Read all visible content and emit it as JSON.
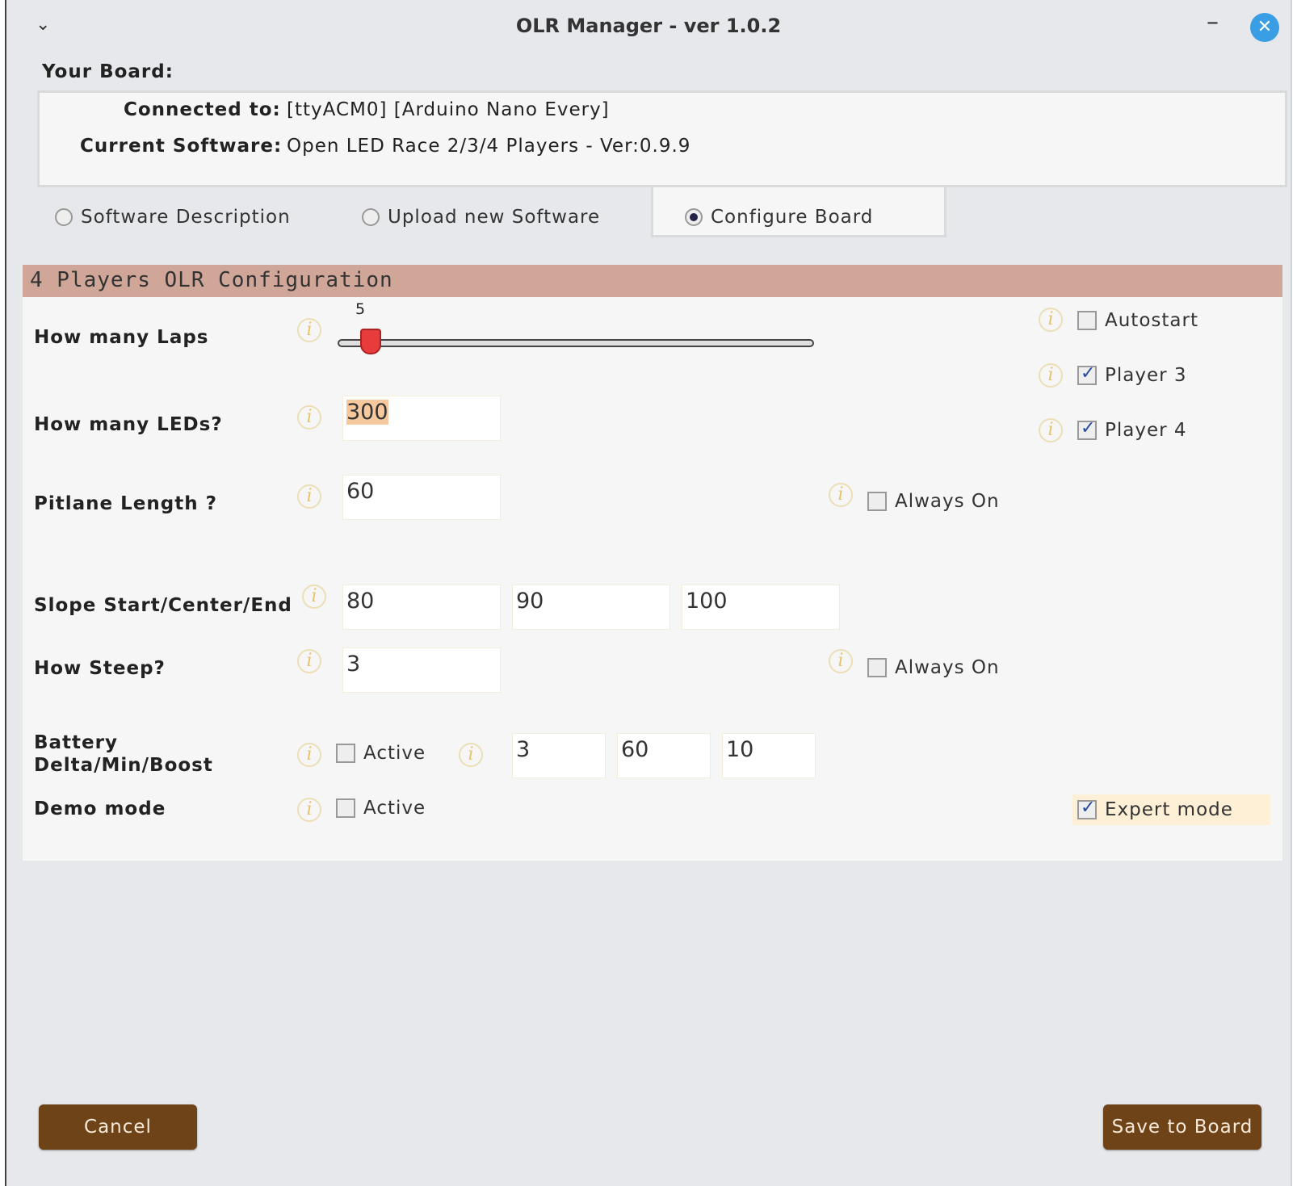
{
  "window": {
    "title": "OLR Manager - ver 1.0.2"
  },
  "board": {
    "heading": "Your Board:",
    "connected_label": "Connected to:",
    "connected_value": "[ttyACM0] [Arduino Nano Every]",
    "software_label": "Current Software:",
    "software_value": "Open LED Race 2/3/4 Players -  Ver:0.9.9"
  },
  "modes": [
    {
      "label": "Software Description",
      "selected": false
    },
    {
      "label": "Upload new Software",
      "selected": false
    },
    {
      "label": "Configure Board",
      "selected": true
    }
  ],
  "config": {
    "title": "4 Players OLR Configuration",
    "laps": {
      "label": "How many Laps",
      "value": "5"
    },
    "leds": {
      "label": "How many LEDs?",
      "value": "300"
    },
    "pitlane": {
      "label": "Pitlane Length ?",
      "value": "60",
      "always_on_label": "Always On"
    },
    "slope": {
      "label": "Slope Start/Center/End",
      "start": "80",
      "center": "90",
      "end": "100"
    },
    "steep": {
      "label": "How Steep?",
      "value": "3",
      "always_on_label": "Always On"
    },
    "battery": {
      "label_line1": "Battery",
      "label_line2": "Delta/Min/Boost",
      "active_label": "Active",
      "delta": "3",
      "min": "60",
      "boost": "10"
    },
    "demo": {
      "label": "Demo mode",
      "active_label": "Active"
    },
    "autostart": {
      "label": "Autostart",
      "checked": false
    },
    "player3": {
      "label": "Player 3",
      "checked": true
    },
    "player4": {
      "label": "Player 4",
      "checked": true
    },
    "expert": {
      "label": "Expert mode",
      "checked": true
    }
  },
  "buttons": {
    "cancel": "Cancel",
    "save": "Save to Board"
  }
}
